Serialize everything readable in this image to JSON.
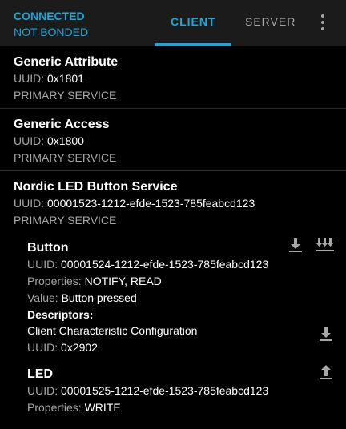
{
  "header": {
    "connection_status": "CONNECTED",
    "bond_status": "NOT BONDED",
    "tabs": [
      {
        "label": "CLIENT",
        "selected": true
      },
      {
        "label": "SERVER",
        "selected": false
      }
    ],
    "more_icon": "more-vert-icon"
  },
  "colors": {
    "accent": "#19a8d8",
    "header_bg": "#1b1b1b",
    "secondary_text": "#a7a7a7"
  },
  "services": [
    {
      "name": "Generic Attribute",
      "uuid_label": "UUID:",
      "uuid": "0x1801",
      "type": "PRIMARY SERVICE"
    },
    {
      "name": "Generic Access",
      "uuid_label": "UUID:",
      "uuid": "0x1800",
      "type": "PRIMARY SERVICE"
    },
    {
      "name": "Nordic LED Button Service",
      "uuid_label": "UUID:",
      "uuid": "00001523-1212-efde-1523-785feabcd123",
      "type": "PRIMARY SERVICE"
    }
  ],
  "characteristics": {
    "button": {
      "name": "Button",
      "uuid_label": "UUID:",
      "uuid": "00001524-1212-efde-1523-785feabcd123",
      "properties_label": "Properties:",
      "properties": "NOTIFY, READ",
      "value_label": "Value:",
      "value": "Button pressed",
      "descriptors_label": "Descriptors:",
      "descriptor": {
        "name": "Client Characteristic Configuration",
        "uuid_label": "UUID:",
        "uuid": "0x2902"
      },
      "icons": [
        "read-icon",
        "notify-icon"
      ]
    },
    "led": {
      "name": "LED",
      "uuid_label": "UUID:",
      "uuid": "00001525-1212-efde-1523-785feabcd123",
      "properties_label": "Properties:",
      "properties": "WRITE",
      "icons": [
        "write-icon"
      ]
    }
  }
}
